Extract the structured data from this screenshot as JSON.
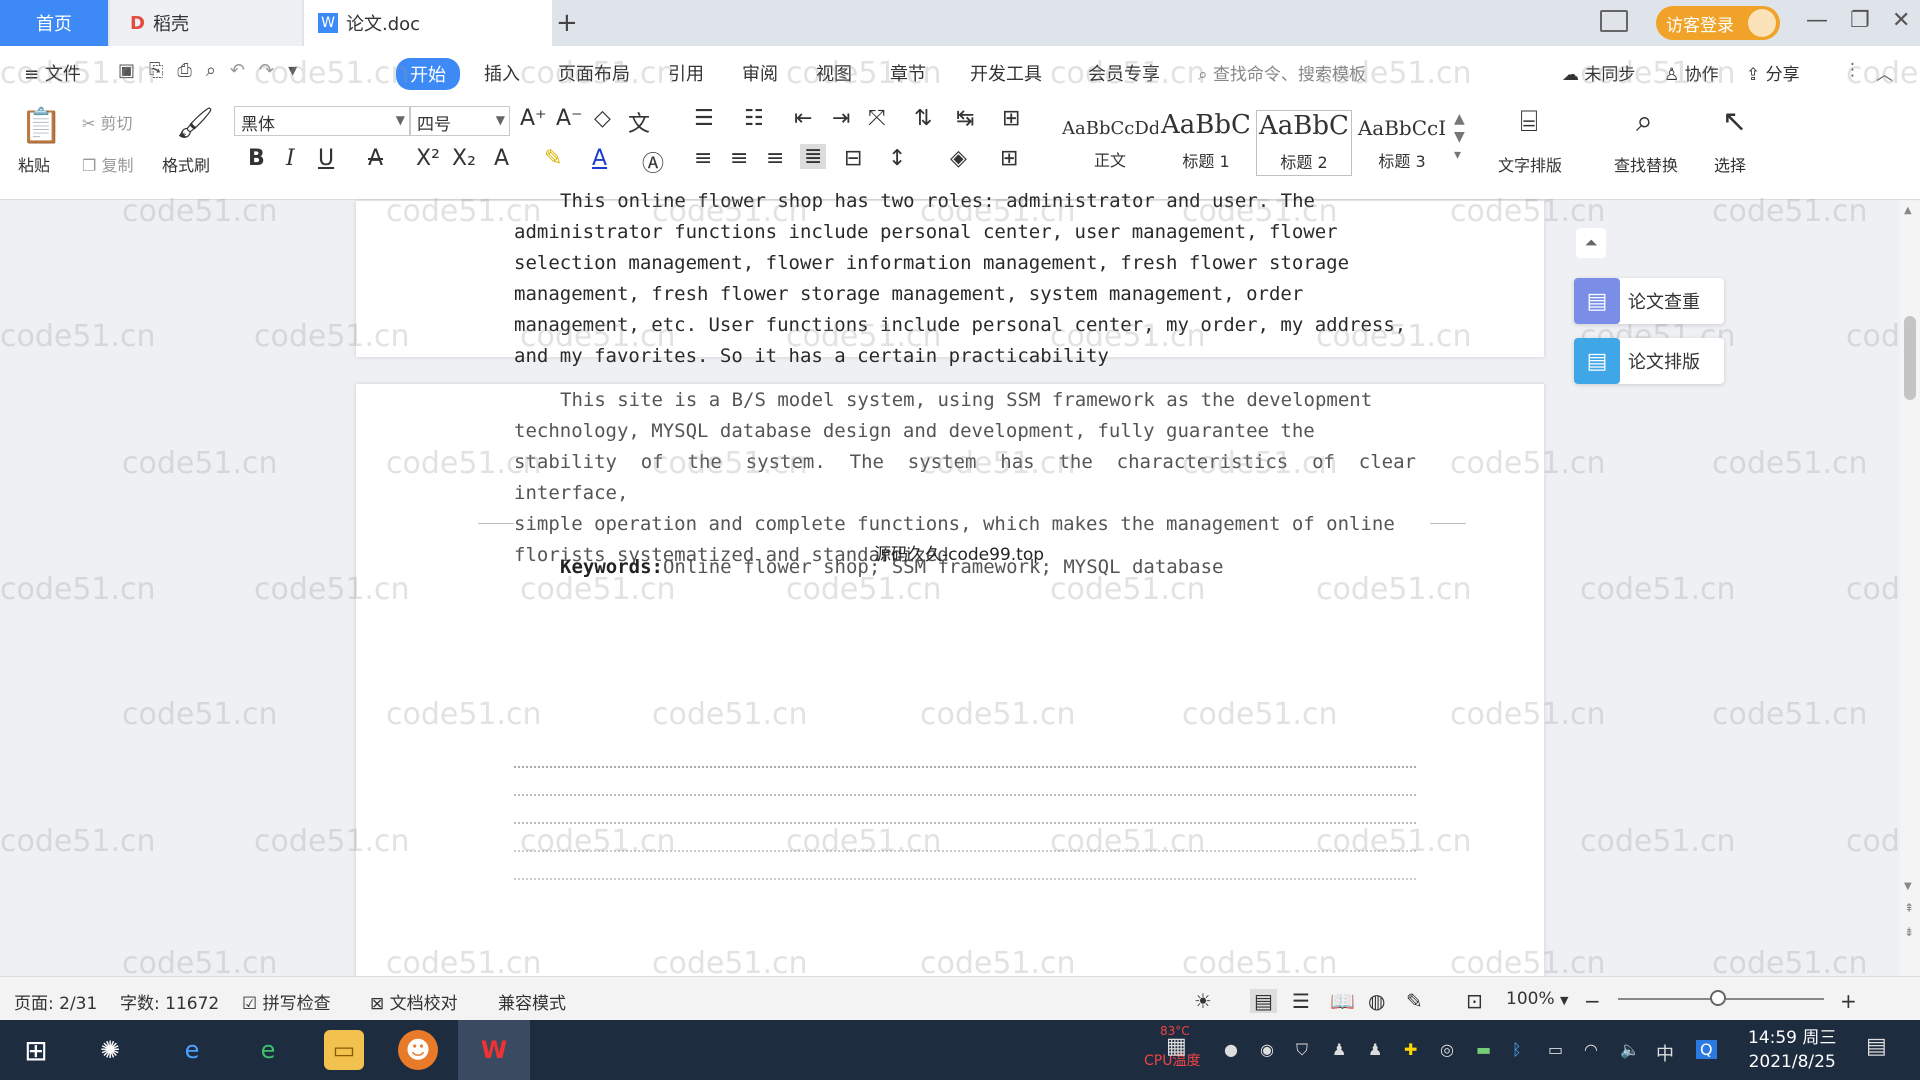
{
  "titlebar": {
    "tabs": [
      {
        "label": "首页"
      },
      {
        "label": "稻壳"
      },
      {
        "label": "论文.doc"
      }
    ],
    "guest_login": "访客登录"
  },
  "menubar": {
    "file": "文件",
    "items": [
      "开始",
      "插入",
      "页面布局",
      "引用",
      "审阅",
      "视图",
      "章节",
      "开发工具",
      "会员专享"
    ],
    "search_placeholder": "查找命令、搜索模板",
    "sync": "未同步",
    "collab": "协作",
    "share": "分享"
  },
  "ribbon": {
    "paste": "粘贴",
    "cut": "剪切",
    "copy": "复制",
    "format_painter": "格式刷",
    "font_name": "黑体",
    "font_size": "四号",
    "styles": [
      {
        "preview": "AaBbCcDd",
        "label": "正文"
      },
      {
        "preview": "AaBbC",
        "label": "标题 1"
      },
      {
        "preview": "AaBbC",
        "label": "标题 2"
      },
      {
        "preview": "AaBbCcI",
        "label": "标题 3"
      }
    ],
    "text_layout": "文字排版",
    "find_replace": "查找替换",
    "select": "选择"
  },
  "document": {
    "page1_lines": [
      "This online flower shop has two roles: administrator and user. The",
      "administrator functions include personal center, user management, flower",
      "selection management, flower information management, fresh flower storage",
      "management, fresh flower storage management, system management, order",
      "management, etc. User functions include personal center, my order, my address,",
      "and my favorites. So it has a certain practicability"
    ],
    "page2_lines": [
      "This site is a B/S model system, using SSM framework as the development",
      "technology, MYSQL database design and development, fully guarantee the",
      "stability of the system. The system has the characteristics of clear interface,",
      "simple operation and complete functions, which makes the management of online",
      "florists systematized and standardized"
    ],
    "watermark_center": "源码久久-code99.top",
    "keywords_label": "Keywords:",
    "keywords_text": "Online flower shop; SSM framework; MYSQL database"
  },
  "side_panel": {
    "check": "论文查重",
    "layout": "论文排版"
  },
  "watermark_text": "code51.cn",
  "statusbar": {
    "page": "页面: 2/31",
    "word_count": "字数: 11672",
    "spell_check": "拼写检查",
    "doc_proof": "文档校对",
    "compat_mode": "兼容模式",
    "zoom": "100%"
  },
  "taskbar": {
    "cpu_temp": "83°C",
    "cpu_label": "CPU温度",
    "ime": "中",
    "time": "14:59 周三",
    "date": "2021/8/25"
  },
  "colors": {
    "accent": "#3d8af7",
    "guest_button": "#f0a328",
    "taskbar": "#1e2c3f"
  }
}
